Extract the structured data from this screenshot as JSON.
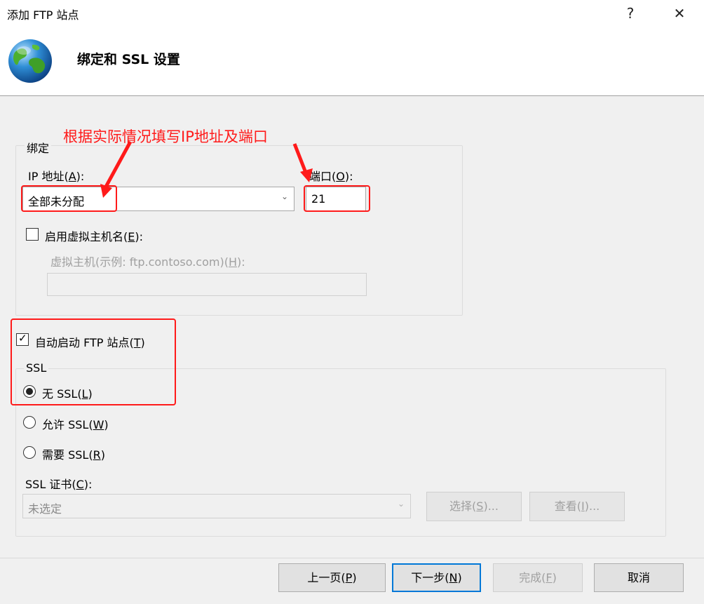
{
  "window": {
    "title": "添加 FTP 站点",
    "help_glyph": "?",
    "close_glyph": "✕"
  },
  "header": {
    "title": "绑定和 SSL 设置",
    "icon": "globe-icon"
  },
  "annotation": {
    "text": "根据实际情况填写IP地址及端口",
    "color": "#ff1a1a"
  },
  "binding": {
    "group_label": "绑定",
    "ip_label_pre": "IP 地址(",
    "ip_label_key": "A",
    "ip_label_post": "):",
    "ip_value": "全部未分配",
    "port_label_pre": "端口(",
    "port_label_key": "O",
    "port_label_post": "):",
    "port_value": "21",
    "vhost_check_pre": "启用虚拟主机名(",
    "vhost_check_key": "E",
    "vhost_check_post": "):",
    "vhost_checked": false,
    "vhost_label_pre": "虚拟主机(示例: ftp.contoso.com)(",
    "vhost_label_key": "H",
    "vhost_label_post": "):",
    "vhost_value": ""
  },
  "autostart": {
    "label_pre": "自动启动 FTP 站点(",
    "label_key": "T",
    "label_post": ")",
    "checked": true
  },
  "ssl": {
    "group_label": "SSL",
    "options": [
      {
        "pre": "无 SSL(",
        "key": "L",
        "post": ")",
        "selected": true
      },
      {
        "pre": "允许 SSL(",
        "key": "W",
        "post": ")",
        "selected": false
      },
      {
        "pre": "需要 SSL(",
        "key": "R",
        "post": ")",
        "selected": false
      }
    ],
    "cert_label_pre": "SSL 证书(",
    "cert_label_key": "C",
    "cert_label_post": "):",
    "cert_value": "未选定",
    "select_btn_pre": "选择(",
    "select_btn_key": "S",
    "select_btn_post": ")...",
    "view_btn_pre": "查看(",
    "view_btn_key": "I",
    "view_btn_post": ")..."
  },
  "footer": {
    "prev_pre": "上一页(",
    "prev_key": "P",
    "prev_post": ")",
    "next_pre": "下一步(",
    "next_key": "N",
    "next_post": ")",
    "finish_pre": "完成(",
    "finish_key": "F",
    "finish_post": ")",
    "cancel": "取消"
  }
}
